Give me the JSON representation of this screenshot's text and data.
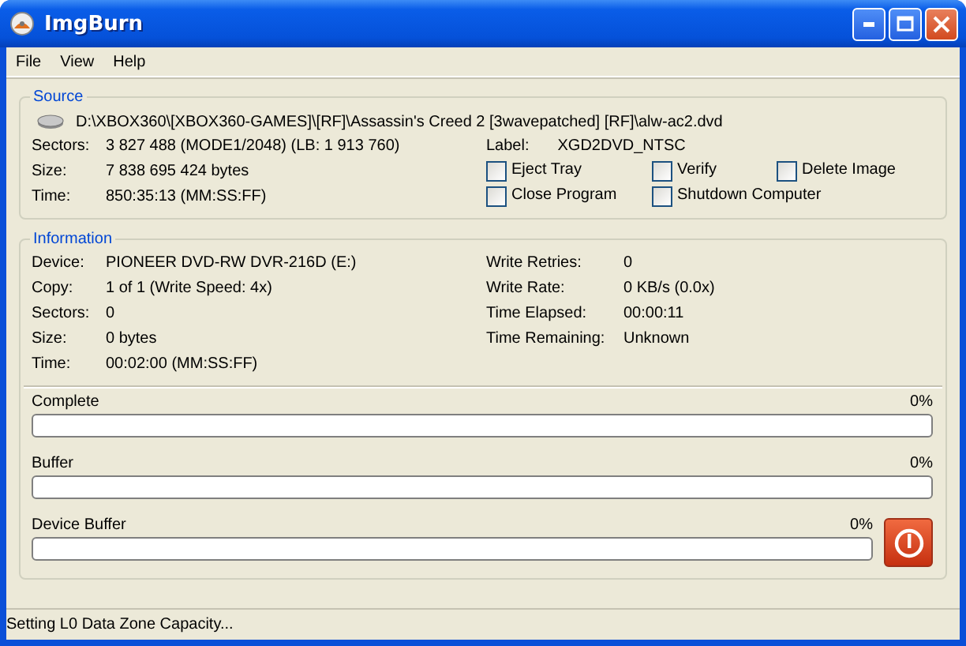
{
  "window": {
    "title": "ImgBurn"
  },
  "menu": [
    "File",
    "View",
    "Help"
  ],
  "source": {
    "title": "Source",
    "path": "D:\\XBOX360\\[XBOX360-GAMES]\\[RF]\\Assassin's Creed 2 [3wavepatched] [RF]\\alw-ac2.dvd",
    "fields": [
      {
        "label": "Sectors:",
        "value": "3 827 488 (MODE1/2048) (LB: 1 913 760)"
      },
      {
        "label": "Size:",
        "value": "7 838 695 424 bytes"
      },
      {
        "label": "Time:",
        "value": "850:35:13 (MM:SS:FF)"
      }
    ],
    "disc_label": {
      "label": "Label:",
      "value": "XGD2DVD_NTSC"
    },
    "options": [
      {
        "label": "Eject Tray",
        "checked": false
      },
      {
        "label": "Verify",
        "checked": false
      },
      {
        "label": "Delete Image",
        "checked": false
      },
      {
        "label": "Close Program",
        "checked": false
      },
      {
        "label": "Shutdown Computer",
        "checked": false
      }
    ]
  },
  "information": {
    "title": "Information",
    "left": [
      {
        "label": "Device:",
        "value": "PIONEER DVD-RW DVR-216D (E:)"
      },
      {
        "label": "Copy:",
        "value": "1 of 1 (Write Speed: 4x)"
      },
      {
        "label": "Sectors:",
        "value": "0"
      },
      {
        "label": "Size:",
        "value": "0 bytes"
      },
      {
        "label": "Time:",
        "value": "00:02:00 (MM:SS:FF)"
      }
    ],
    "right": [
      {
        "label": "Write Retries:",
        "value": "0"
      },
      {
        "label": "Write Rate:",
        "value": "0 KB/s (0.0x)"
      },
      {
        "label": "Time Elapsed:",
        "value": "00:00:11"
      },
      {
        "label": "Time Remaining:",
        "value": "Unknown"
      }
    ],
    "progress": [
      {
        "label": "Complete",
        "reading": "0%",
        "level": 0
      },
      {
        "label": "Buffer",
        "reading": "0%",
        "level": 0
      },
      {
        "label": "Device Buffer",
        "reading": "0%",
        "level": 0
      }
    ]
  },
  "status_bar": "Setting L0 Data Zone Capacity..."
}
